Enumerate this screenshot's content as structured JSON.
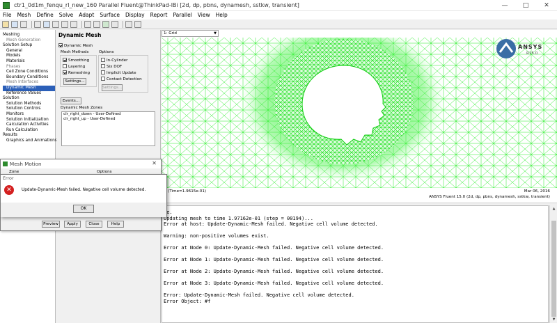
{
  "window": {
    "title": "ctr1_0d1m_fenqu_rl_new_160 Parallel Fluent@ThinkPad-lBi  [2d, dp, pbns, dynamesh, sstkw, transient]",
    "controls": [
      "—",
      "□",
      "✕"
    ]
  },
  "menubar": [
    "File",
    "Mesh",
    "Define",
    "Solve",
    "Adapt",
    "Surface",
    "Display",
    "Report",
    "Parallel",
    "View",
    "Help"
  ],
  "tree": [
    {
      "label": "Meshing",
      "kind": "head"
    },
    {
      "label": "Mesh Generation",
      "kind": "gray"
    },
    {
      "label": "Solution Setup",
      "kind": "head"
    },
    {
      "label": "General",
      "kind": "sub"
    },
    {
      "label": "Models",
      "kind": "sub"
    },
    {
      "label": "Materials",
      "kind": "sub"
    },
    {
      "label": "Phases",
      "kind": "gray"
    },
    {
      "label": "Cell Zone Conditions",
      "kind": "sub"
    },
    {
      "label": "Boundary Conditions",
      "kind": "sub"
    },
    {
      "label": "Mesh Interfaces",
      "kind": "gray"
    },
    {
      "label": "Dynamic Mesh",
      "kind": "selected"
    },
    {
      "label": "Reference Values",
      "kind": "sub"
    },
    {
      "label": "Solution",
      "kind": "head"
    },
    {
      "label": "Solution Methods",
      "kind": "sub"
    },
    {
      "label": "Solution Controls",
      "kind": "sub"
    },
    {
      "label": "Monitors",
      "kind": "sub"
    },
    {
      "label": "Solution Initialization",
      "kind": "sub"
    },
    {
      "label": "Calculation Activities",
      "kind": "sub"
    },
    {
      "label": "Run Calculation",
      "kind": "sub"
    },
    {
      "label": "Results",
      "kind": "head"
    },
    {
      "label": "Graphics and Animations",
      "kind": "sub"
    }
  ],
  "task": {
    "title": "Dynamic Mesh",
    "dynamic_mesh_label": "Dynamic Mesh",
    "dynamic_mesh_checked": true,
    "mesh_methods_label": "Mesh Methods",
    "methods": [
      {
        "label": "Smoothing",
        "checked": true
      },
      {
        "label": "Layering",
        "checked": false
      },
      {
        "label": "Remeshing",
        "checked": true
      }
    ],
    "settings_label": "Settings...",
    "options_label": "Options",
    "options": [
      {
        "label": "In-Cylinder",
        "checked": false
      },
      {
        "label": "Six DOF",
        "checked": false
      },
      {
        "label": "Implicit Update",
        "checked": false
      },
      {
        "label": "Contact Detection",
        "checked": false
      }
    ],
    "options_settings_label": "Settings...",
    "events_label": "Events...",
    "zones_label": "Dynamic Mesh Zones",
    "zones": [
      "clr_right_down - User-Defined",
      "clr_right_up - User-Defined"
    ]
  },
  "graphics": {
    "window_selector": "1: Grid",
    "logo_word": "ANSYS",
    "logo_version": "R15.0",
    "info_left": "rid  (Time=1.9615e-01)",
    "date": "Mar 06, 2016",
    "version": "ANSYS Fluent 15.0 (2d, dp, pbns, dynamesh, sstkw, transient)"
  },
  "console": {
    "lines": [
      "me.",
      "Updating mesh to time 1.97162e-01 (step = 00194)...",
      "Error at host: Update-Dynamic-Mesh failed. Negative cell volume detected.",
      "",
      "Warning: non-positive volumes exist.",
      "",
      "Error at Node 0: Update-Dynamic-Mesh failed. Negative cell volume detected.",
      "",
      "Error at Node 1: Update-Dynamic-Mesh failed. Negative cell volume detected.",
      "",
      "Error at Node 2: Update-Dynamic-Mesh failed. Negative cell volume detected.",
      "",
      "Error at Node 3: Update-Dynamic-Mesh failed. Negative cell volume detected.",
      "",
      "Error: Update-Dynamic-Mesh failed. Negative cell volume detected.",
      "Error Object: #f"
    ]
  },
  "mesh_motion": {
    "title": "Mesh Motion",
    "close": "✕",
    "col_zone": "Zone",
    "col_options": "Options",
    "buttons": [
      "Preview",
      "Apply",
      "Close",
      "Help"
    ]
  },
  "error_dialog": {
    "title": "Error",
    "icon": "✕",
    "message": "Update-Dynamic-Mesh failed. Negative cell volume detected.",
    "ok_label": "OK"
  },
  "colors": {
    "mesh_green": "#22ee22",
    "selection_blue": "#2b5fb8",
    "error_red": "#d42020"
  }
}
